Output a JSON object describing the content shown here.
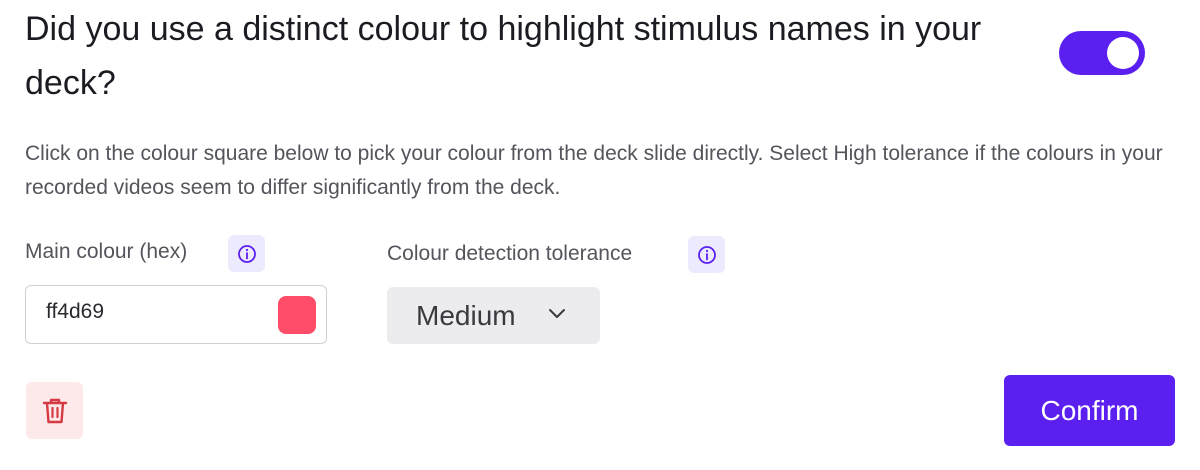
{
  "question": {
    "title": "Did you use a distinct colour to highlight stimulus names in your deck?",
    "toggle_on": true
  },
  "description": "Click on the colour square below to pick your colour from the deck slide directly. Select High tolerance if the colours in your recorded videos seem to differ significantly from the deck.",
  "main_colour": {
    "label": "Main colour (hex)",
    "value": "ff4d69",
    "swatch_color": "#ff4d69",
    "info_icon": "info-icon"
  },
  "tolerance": {
    "label": "Colour detection tolerance",
    "selected": "Medium",
    "info_icon": "info-icon"
  },
  "actions": {
    "delete_icon": "trash-icon",
    "confirm_label": "Confirm"
  },
  "colors": {
    "accent": "#5b1ff0",
    "danger": "#d63a45",
    "danger_bg": "#fde9ea"
  }
}
